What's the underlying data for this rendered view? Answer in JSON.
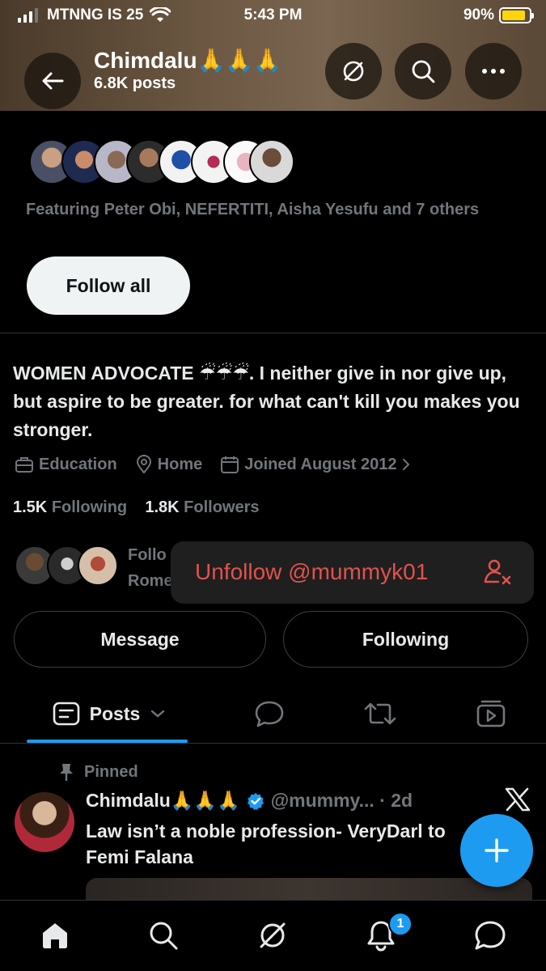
{
  "status": {
    "carrier": "MTNNG IS 25",
    "time": "5:43 PM",
    "battery": "90%"
  },
  "header": {
    "name": "Chimdalu🙏🙏🙏",
    "posts": "6.8K posts"
  },
  "featuring": {
    "text": "Featuring Peter Obi, NEFERTITI, Aisha Yesufu and 7 others",
    "follow_all": "Follow all"
  },
  "profile": {
    "bio": "WOMEN ADVOCATE ☔☔☔. I neither give in nor give up, but aspire to be greater. for what can't kill you makes you stronger.",
    "meta": {
      "category": "Education",
      "location": "Home",
      "joined": "Joined August 2012"
    },
    "following_count": "1.5K",
    "following_label": "Following",
    "followers_count": "1.8K",
    "followers_label": "Followers",
    "followed_by_line1": "Follo",
    "followed_by_line2": "Rome"
  },
  "toast": {
    "label": "Unfollow @mummyk01"
  },
  "actions": {
    "message": "Message",
    "following": "Following"
  },
  "tabs": {
    "posts": "Posts"
  },
  "post": {
    "pinned_label": "Pinned",
    "author": "Chimdalu🙏🙏🙏",
    "handle_time": "@mummy... · 2d",
    "text": "Law isn’t a noble profession- VeryDarl to Femi Falana"
  },
  "nav": {
    "notifications_badge": "1"
  },
  "colors": {
    "accent": "#1d9bf0",
    "danger": "#e0524d",
    "muted": "#71767b"
  }
}
